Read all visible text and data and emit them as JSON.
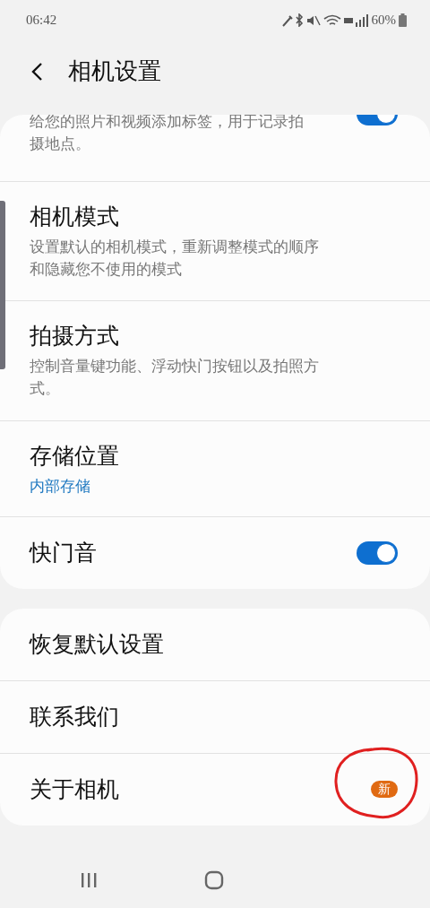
{
  "status_bar": {
    "time": "06:42",
    "battery": "60%"
  },
  "header": {
    "title": "相机设置"
  },
  "groups": [
    {
      "items": [
        {
          "kind": "toggle",
          "description": "给您的照片和视频添加标签，用于记录拍摄地点。",
          "on": true,
          "partial": true
        },
        {
          "kind": "link",
          "title": "相机模式",
          "description": "设置默认的相机模式，重新调整模式的顺序和隐藏您不使用的模式"
        },
        {
          "kind": "link",
          "title": "拍摄方式",
          "description": "控制音量键功能、浮动快门按钮以及拍照方式。"
        },
        {
          "kind": "value",
          "title": "存储位置",
          "value": "内部存储"
        },
        {
          "kind": "toggle",
          "title": "快门音",
          "on": true
        }
      ]
    },
    {
      "items": [
        {
          "kind": "link",
          "title": "恢复默认设置"
        },
        {
          "kind": "link",
          "title": "联系我们"
        },
        {
          "kind": "link",
          "title": "关于相机",
          "badge": "新",
          "circled": true
        }
      ]
    }
  ]
}
